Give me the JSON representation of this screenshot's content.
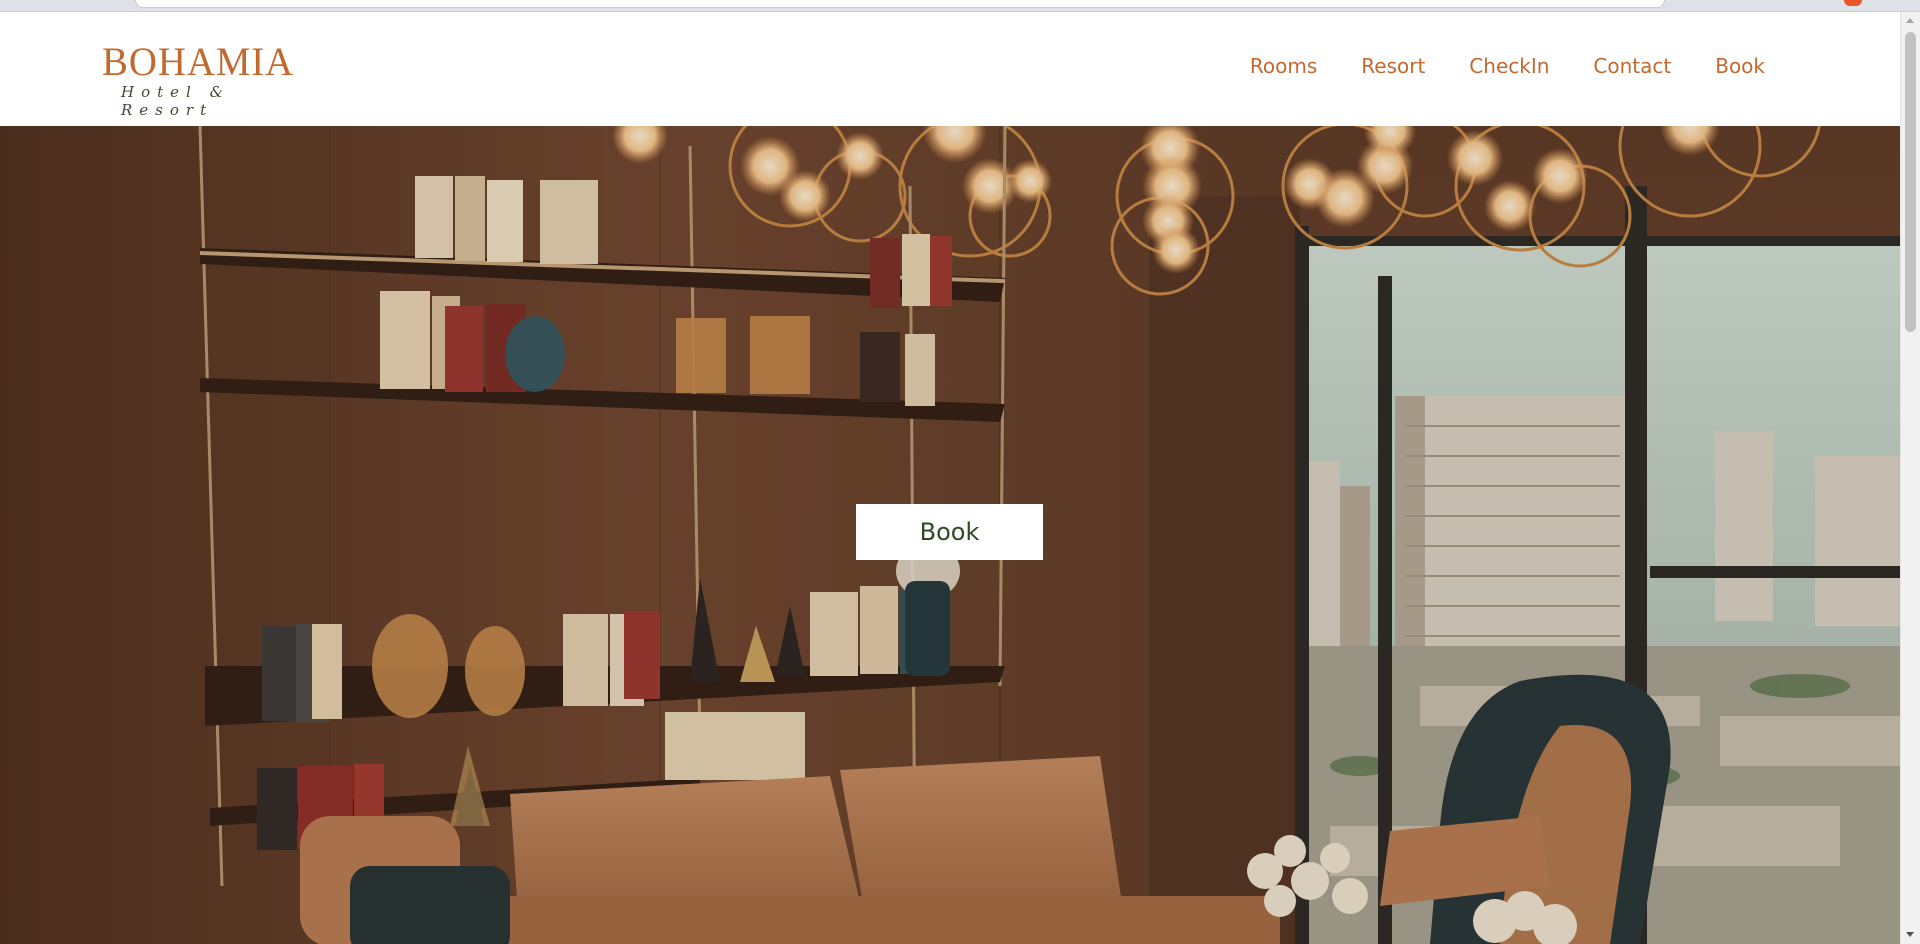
{
  "brand": {
    "name": "BOHAMIA",
    "tagline": "Hotel & Resort"
  },
  "nav": {
    "items": [
      {
        "label": "Rooms"
      },
      {
        "label": "Resort"
      },
      {
        "label": "CheckIn"
      },
      {
        "label": "Contact"
      },
      {
        "label": "Book"
      }
    ]
  },
  "hero": {
    "cta_label": "Book",
    "image": "hotel-lobby-photo"
  },
  "colors": {
    "accent": "#c2692f",
    "tagline": "#3c4a2f",
    "cta_text": "#2f4a22"
  }
}
